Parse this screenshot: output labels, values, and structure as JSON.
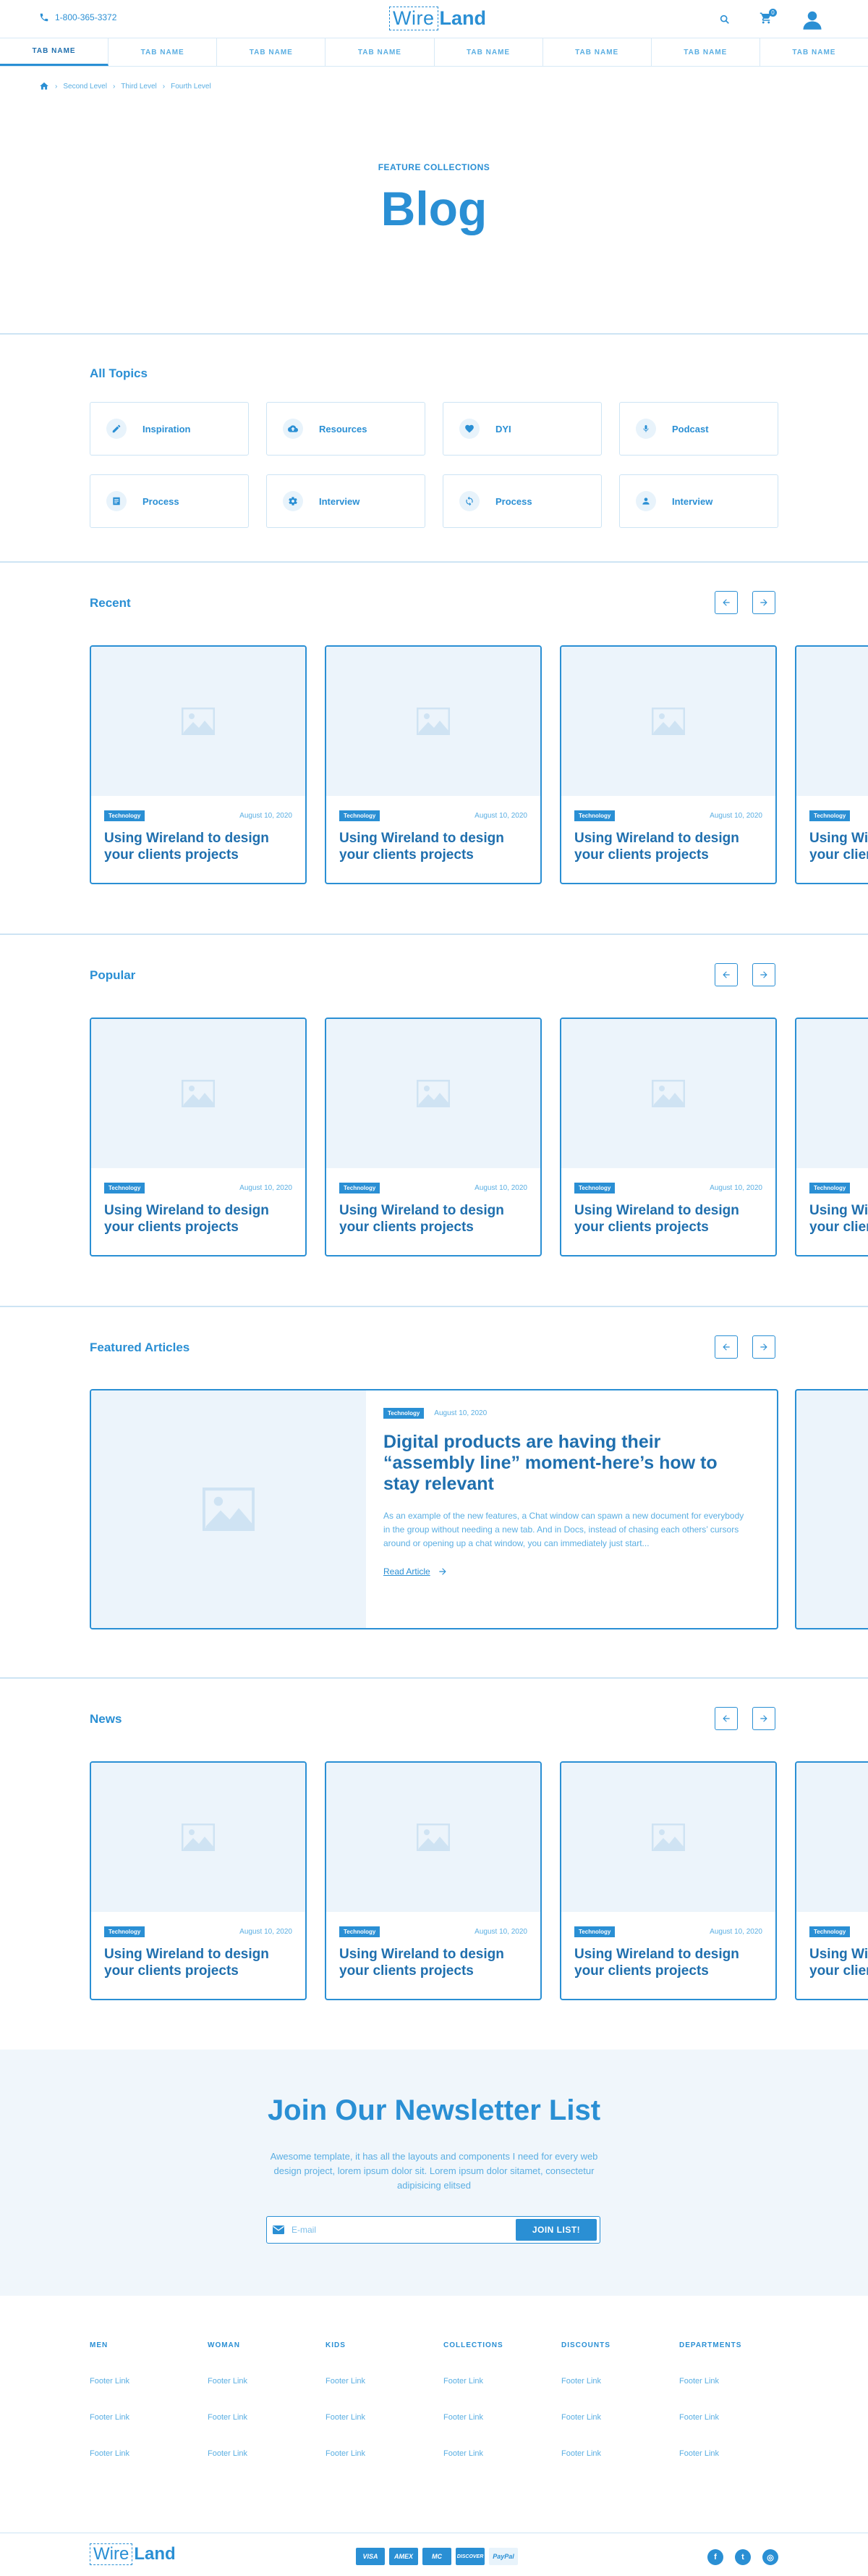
{
  "header": {
    "phone": "1-800-365-3372",
    "logo_left": "Wire",
    "logo_right": "Land",
    "cart_count": "0"
  },
  "tabs": [
    "TAB NAME",
    "TAB NAME",
    "TAB NAME",
    "TAB NAME",
    "TAB NAME",
    "TAB NAME",
    "TAB NAME",
    "TAB NAME"
  ],
  "breadcrumb": [
    "Second Level",
    "Third Level",
    "Fourth Level"
  ],
  "hero": {
    "eyebrow": "FEATURE COLLECTIONS",
    "title": "Blog"
  },
  "topics": {
    "title": "All Topics",
    "items": [
      {
        "label": "Inspiration",
        "icon": "pencil-icon"
      },
      {
        "label": "Resources",
        "icon": "cloud-upload-icon"
      },
      {
        "label": "DYI",
        "icon": "heart-icon"
      },
      {
        "label": "Podcast",
        "icon": "microphone-icon"
      },
      {
        "label": "Process",
        "icon": "list-icon"
      },
      {
        "label": "Interview",
        "icon": "gear-icon"
      },
      {
        "label": "Process",
        "icon": "sync-icon"
      },
      {
        "label": "Interview",
        "icon": "person-icon"
      }
    ]
  },
  "card": {
    "tag": "Technology",
    "date": "August 10, 2020",
    "title": "Using Wireland to design your clients projects"
  },
  "recent": {
    "title": "Recent"
  },
  "popular": {
    "title": "Popular"
  },
  "featured": {
    "title": "Featured Articles",
    "tag": "Technology",
    "date": "August 10, 2020",
    "headline": "Digital products are having their “assembly line” moment-here’s how to stay relevant",
    "excerpt": "As an example of the new features, a Chat window can spawn a new document for everybody in the group without needing a new tab. And in Docs, instead of chasing each others’ cursors around or opening up a chat window, you can immediately just start...",
    "read_more": "Read Article"
  },
  "news": {
    "title": "News"
  },
  "newsletter": {
    "title": "Join Our Newsletter List",
    "text": "Awesome template, it has all the layouts and components I need for every web design project, lorem ipsum dolor sit. Lorem ipsum dolor sitamet, consectetur adipisicing elitsed",
    "placeholder": "E-mail",
    "button": "JOIN LIST!"
  },
  "footer": {
    "columns": [
      {
        "heading": "MEN",
        "links": [
          "Footer Link",
          "Footer Link",
          "Footer Link"
        ]
      },
      {
        "heading": "WOMAN",
        "links": [
          "Footer Link",
          "Footer Link",
          "Footer Link"
        ]
      },
      {
        "heading": "KIDS",
        "links": [
          "Footer Link",
          "Footer Link",
          "Footer Link"
        ]
      },
      {
        "heading": "COLLECTIONS",
        "links": [
          "Footer Link",
          "Footer Link",
          "Footer Link"
        ]
      },
      {
        "heading": "DISCOUNTS",
        "links": [
          "Footer Link",
          "Footer Link",
          "Footer Link"
        ]
      },
      {
        "heading": "DEPARTMENTS",
        "links": [
          "Footer Link",
          "Footer Link",
          "Footer Link"
        ]
      }
    ],
    "logo_left": "Wire",
    "logo_right": "Land",
    "payments": [
      "VISA",
      "AMEX",
      "MC",
      "DISCOVER",
      "PayPal"
    ],
    "social": [
      "facebook-icon",
      "twitter-icon",
      "instagram-icon"
    ]
  },
  "colors": {
    "accent": "#2a8fd4",
    "light_bg": "#f0f6fb",
    "border": "#cde4f4"
  }
}
